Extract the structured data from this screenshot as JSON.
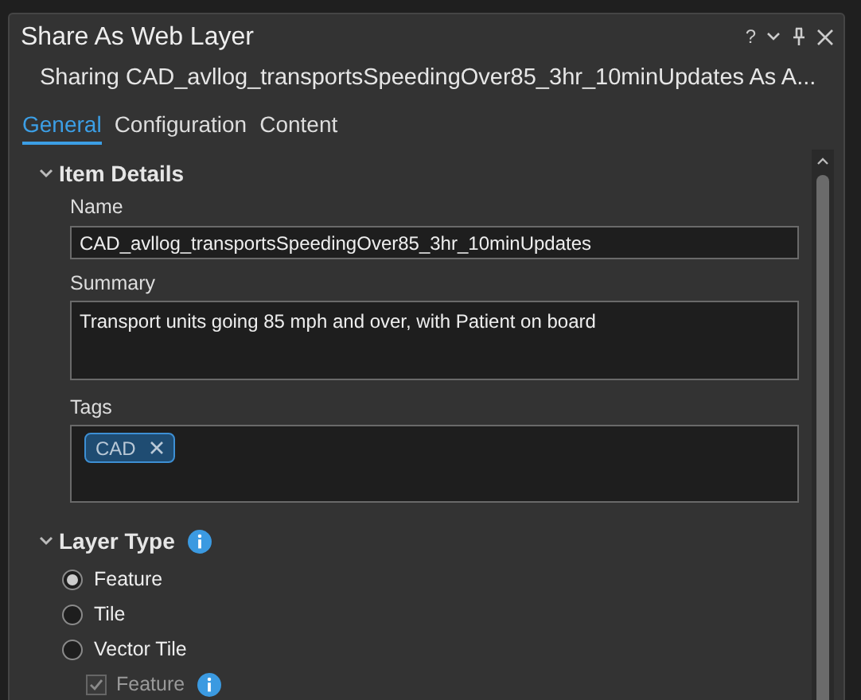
{
  "window": {
    "title": "Share As Web Layer",
    "subtitle": "Sharing CAD_avllog_transportsSpeedingOver85_3hr_10minUpdates As A...",
    "controls": [
      "?"
    ]
  },
  "tabs": [
    {
      "label": "General",
      "selected": true
    },
    {
      "label": "Configuration",
      "selected": false
    },
    {
      "label": "Content",
      "selected": false
    }
  ],
  "item_details": {
    "heading": "Item Details",
    "expanded": true,
    "name": {
      "label": "Name",
      "value": "CAD_avllog_transportsSpeedingOver85_3hr_10minUpdates"
    },
    "summary": {
      "label": "Summary",
      "value": "Transport units going 85 mph and over, with Patient on board"
    },
    "tags": {
      "label": "Tags",
      "items": [
        "CAD"
      ]
    }
  },
  "layer_type": {
    "heading": "Layer Type",
    "expanded": true,
    "options": [
      {
        "label": "Feature",
        "selected": true
      },
      {
        "label": "Tile",
        "selected": false
      },
      {
        "label": "Vector Tile",
        "selected": false
      }
    ],
    "sub_option": {
      "label": "Feature",
      "checked": true,
      "disabled": true
    }
  }
}
